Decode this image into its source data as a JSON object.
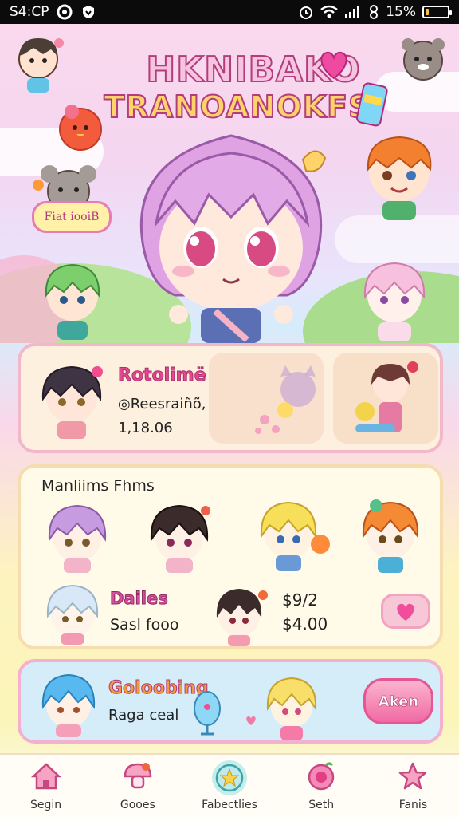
{
  "status_bar": {
    "time": "S4:CP",
    "battery": "15%",
    "battery_level": 0.15
  },
  "hero": {
    "title_line1": "HKNIBAKO",
    "title_line2": "TRANOANOKFS",
    "sticker_label": "Fiat iooiB"
  },
  "card_featured": {
    "title": "Rotolimë",
    "line1": "◎Reesraiñõ,",
    "line2": "1,18.06"
  },
  "card_list": {
    "title": "Manliims Fhms",
    "item_title": "Dailes",
    "item_subtitle": "Sasl fooo",
    "price_primary": "$9/2",
    "price_secondary": "$4.00"
  },
  "card_collect": {
    "title": "Goloobing",
    "subtitle": "Raga ceal",
    "button_label": "Aken"
  },
  "bottom_nav": {
    "items": [
      {
        "label": "Segin",
        "icon": "home-icon"
      },
      {
        "label": "Gooes",
        "icon": "mushroom-icon"
      },
      {
        "label": "Fabectlies",
        "icon": "star-badge-icon"
      },
      {
        "label": "Seth",
        "icon": "gem-icon"
      },
      {
        "label": "Fanis",
        "icon": "star-icon"
      }
    ],
    "active_index": 2
  },
  "colors": {
    "accent_pink": "#e6488f",
    "nav_active": "#c6ecec",
    "battery_fill": "#f6c53b"
  }
}
